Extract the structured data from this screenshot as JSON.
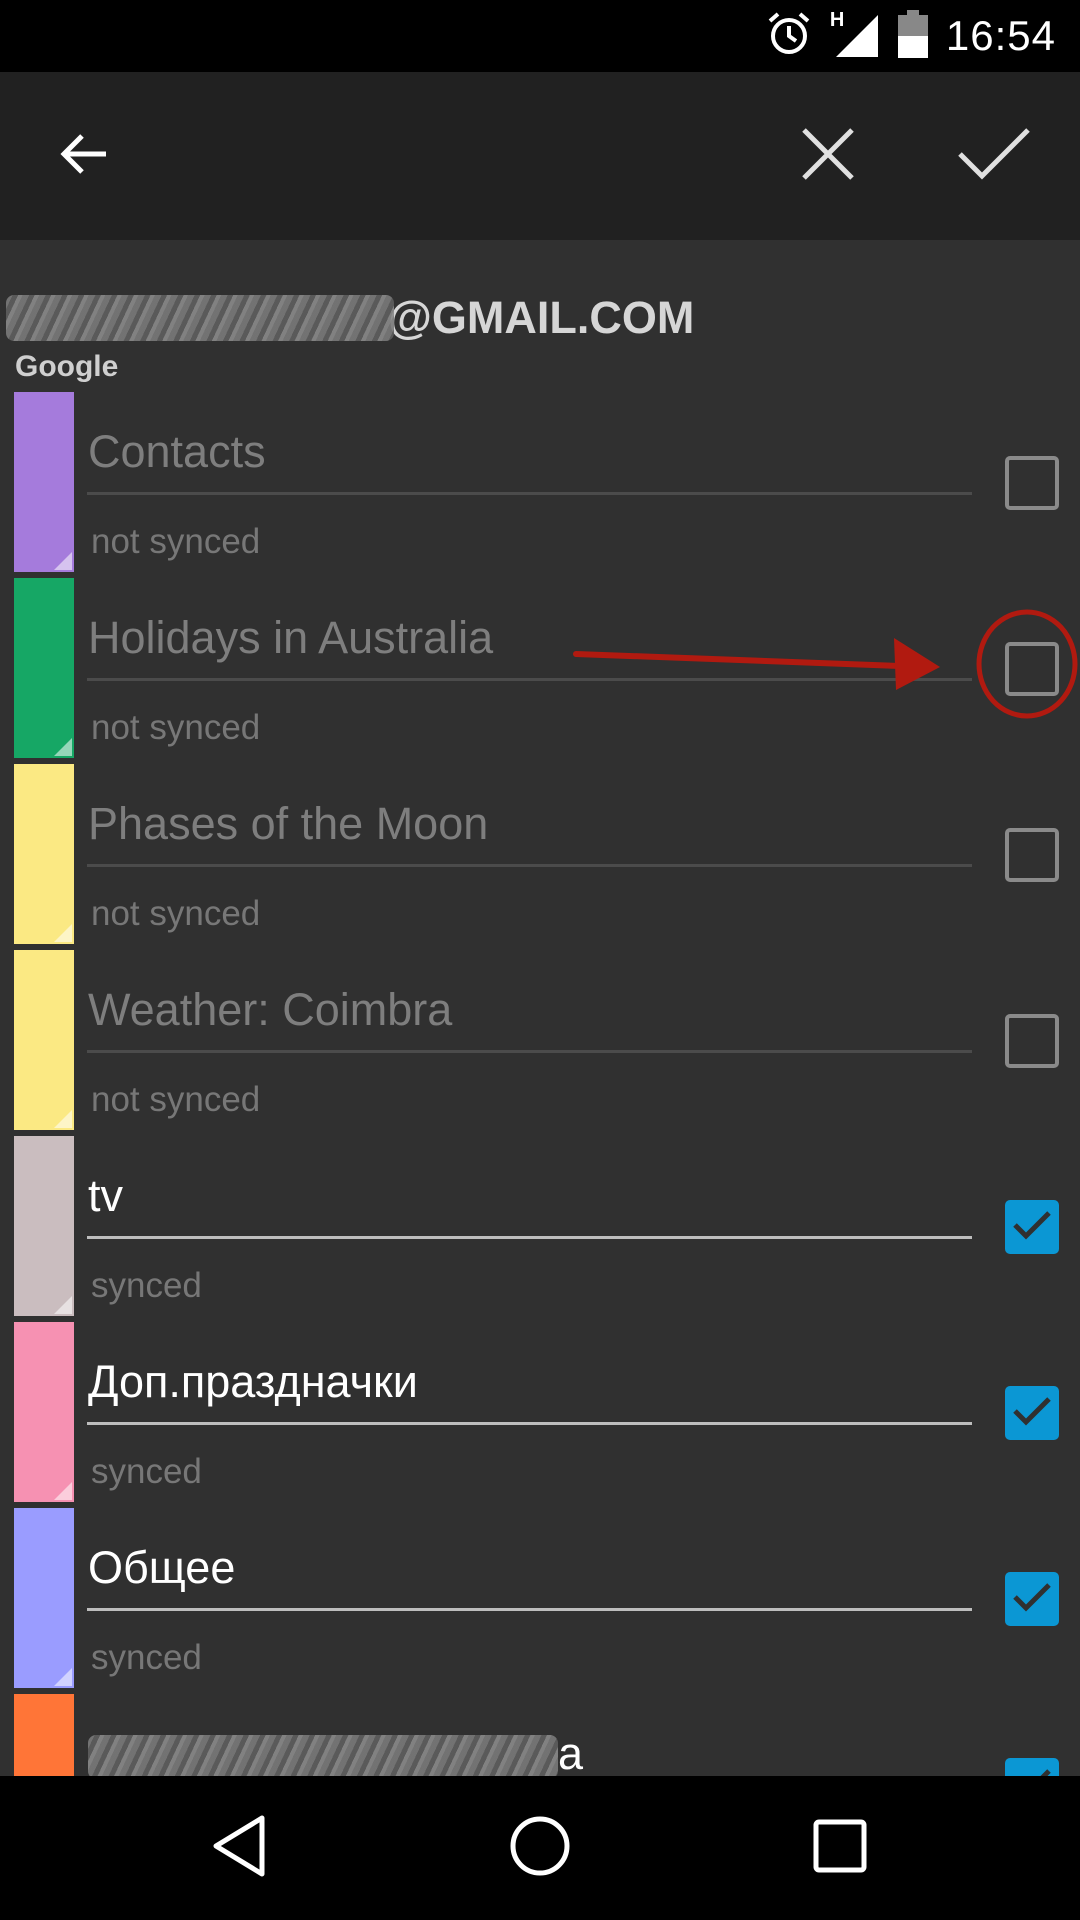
{
  "status_bar": {
    "time": "16:54",
    "network_label": "H",
    "icons": [
      "alarm-icon",
      "signal-icon",
      "battery-icon"
    ]
  },
  "toolbar": {
    "back_icon": "arrow-left-icon",
    "cancel_icon": "close-icon",
    "confirm_icon": "check-icon"
  },
  "account": {
    "email_suffix": "@GMAIL.COM",
    "provider": "Google"
  },
  "calendars": [
    {
      "name": "Contacts",
      "status": "not synced",
      "checked": false,
      "color": "#a57bdc"
    },
    {
      "name": "Holidays in Australia",
      "status": "not synced",
      "checked": false,
      "color": "#16a765"
    },
    {
      "name": "Phases of the Moon",
      "status": "not synced",
      "checked": false,
      "color": "#fbe983"
    },
    {
      "name": "Weather: Coimbra",
      "status": "not synced",
      "checked": false,
      "color": "#fbe983"
    },
    {
      "name": "tv",
      "status": "synced",
      "checked": true,
      "color": "#cabdbf"
    },
    {
      "name": "Доп.праздначки",
      "status": "synced",
      "checked": true,
      "color": "#f691b2"
    },
    {
      "name": "Общее",
      "status": "synced",
      "checked": true,
      "color": "#9a9cff"
    },
    {
      "name": "a",
      "status": "",
      "checked": true,
      "color": "#ff7537"
    }
  ],
  "annotation_color": "#b11a10",
  "accent_color": "#0b97d4",
  "nav_bar": {
    "icons": [
      "back-triangle-icon",
      "home-circle-icon",
      "recents-square-icon"
    ]
  }
}
